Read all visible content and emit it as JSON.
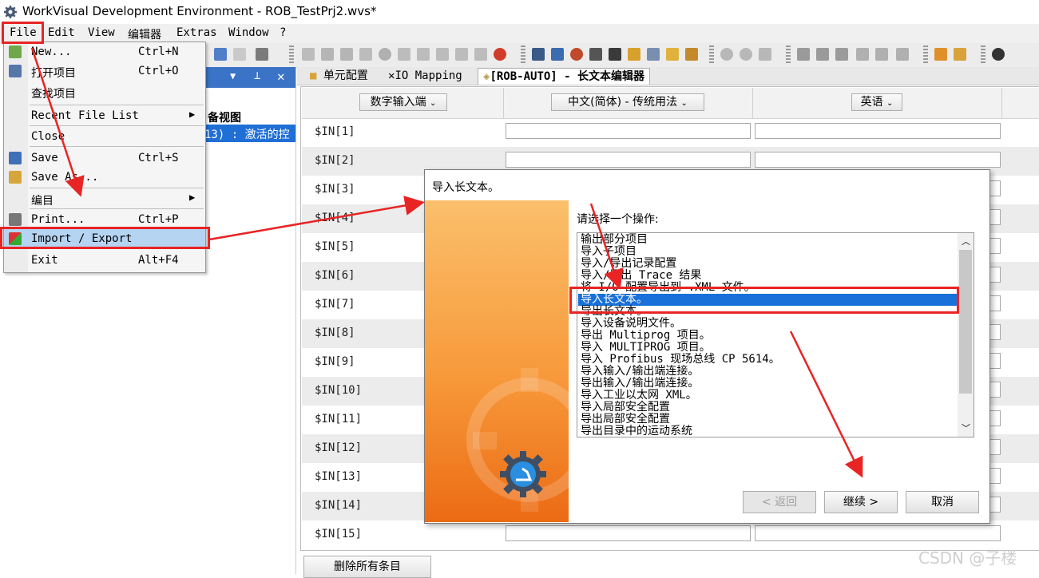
{
  "window": {
    "title": "WorkVisual Development Environment - ROB_TestPrj2.wvs*"
  },
  "menubar": {
    "items": [
      "File",
      "Edit",
      "View",
      "编辑器",
      "Extras",
      "Window",
      "?"
    ]
  },
  "file_menu": {
    "items": [
      {
        "label": "New...",
        "shortcut": "Ctrl+N",
        "icon": "new-icon"
      },
      {
        "label": "打开项目",
        "shortcut": "Ctrl+O",
        "icon": "open-icon"
      },
      {
        "label": "查找项目",
        "shortcut": "",
        "icon": ""
      },
      {
        "label": "Recent File List",
        "shortcut": "",
        "icon": "",
        "submenu": true
      },
      {
        "label": "Close",
        "shortcut": "",
        "icon": ""
      },
      {
        "label": "Save",
        "shortcut": "Ctrl+S",
        "icon": "save-icon"
      },
      {
        "label": "Save As...",
        "shortcut": "",
        "icon": "save-as-icon"
      },
      {
        "label": "编目",
        "shortcut": "",
        "icon": "",
        "submenu": true
      },
      {
        "label": "Print...",
        "shortcut": "Ctrl+P",
        "icon": "print-icon"
      },
      {
        "label": "Import / Export",
        "shortcut": "",
        "icon": "import-export-icon"
      },
      {
        "label": "Exit",
        "shortcut": "Alt+F4",
        "icon": ""
      }
    ]
  },
  "left_panel": {
    "device_view_label": "备视图",
    "selected_item": "13) : 激活的控"
  },
  "tabs": [
    {
      "label": "单元配置",
      "icon": "cell-config-icon"
    },
    {
      "label": "IO Mapping",
      "icon": "io-mapping-icon"
    },
    {
      "label": "[ROB-AUTO] - 长文本编辑器",
      "icon": "long-text-editor-icon",
      "active": true
    }
  ],
  "editor": {
    "header": {
      "col1": "数字输入端",
      "col2": "中文(简体) - 传统用法",
      "col3": "英语"
    },
    "rows": [
      "$IN[1]",
      "$IN[2]",
      "$IN[3]",
      "$IN[4]",
      "$IN[5]",
      "$IN[6]",
      "$IN[7]",
      "$IN[8]",
      "$IN[9]",
      "$IN[10]",
      "$IN[11]",
      "$IN[12]",
      "$IN[13]",
      "$IN[14]",
      "$IN[15]"
    ],
    "delete_all_label": "删除所有条目"
  },
  "dialog": {
    "title": "导入长文本。",
    "prompt": "请选择一个操作:",
    "options": [
      "输出部分项目",
      "导入子项目",
      "导入/导出记录配置",
      "导入/导出 Trace 结果",
      "将 I/O 配置导出到 .XML 文件。",
      "导入长文本。",
      "导出长文本。",
      "导入设备说明文件。",
      "导出 Multiprog 项目。",
      "导入 MULTIPROG 项目。",
      "导入 Profibus 现场总线 CP 5614。",
      "导入输入/输出端连接。",
      "导出输入/输出端连接。",
      "导入工业以太网 XML。",
      "导入局部安全配置",
      "导出局部安全配置",
      "导出目录中的运动系统"
    ],
    "selected_index": 5,
    "buttons": {
      "back": "< 返回",
      "continue": "继续 >",
      "cancel": "取消"
    }
  },
  "watermark": "CSDN @子楼",
  "colors": {
    "selection": "#1870d8",
    "menu_highlight": "#b5d4f1",
    "annotation": "#e82424",
    "dialog_side": "#f7993a"
  }
}
